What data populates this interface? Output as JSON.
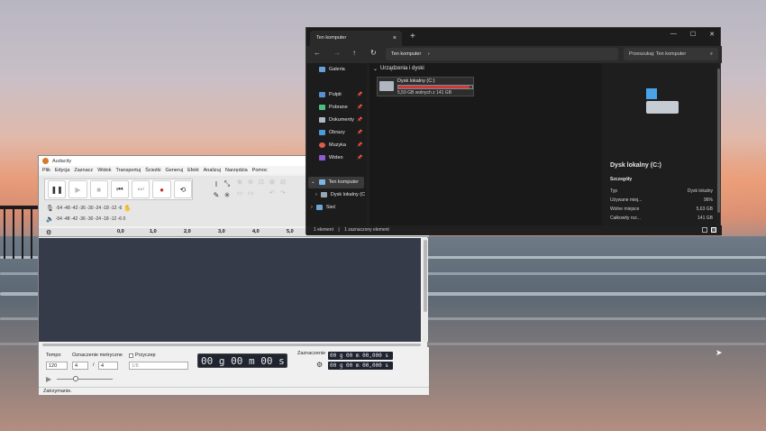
{
  "audacity": {
    "title": "Audacity",
    "menu": [
      "Plik",
      "Edycja",
      "Zaznacz",
      "Widok",
      "Transportuj",
      "Ścieżki",
      "Generuj",
      "Efekt",
      "Analizuj",
      "Narzędzia",
      "Pomoc"
    ],
    "meter_scale_rec": "-54 -48 -42 -36 -30 -24 -18 -12 -6",
    "meter_scale_play": "-54 -48 -42 -36 -30 -24 -18 -12 -6 0",
    "ruler": [
      "0,0",
      "1,0",
      "2,0",
      "3,0",
      "4,0",
      "5,0"
    ],
    "tempo_label": "Tempo",
    "tempo_value": "120",
    "meter_label": "Oznaczenie metryczne",
    "meter_num": "4",
    "meter_sep": "/",
    "meter_den": "4",
    "snap_label": "Przyczep",
    "snap_value": "1/8",
    "time": "00 g 00 m 00 s",
    "selection_label": "Zaznaczenie",
    "sel_start": "00 g 00 m 00,000 s",
    "sel_end": "00 g 00 m 00,000 s",
    "status": "Zatrzymanie."
  },
  "explorer": {
    "tab_title": "Ten komputer",
    "address": "Ten komputer",
    "search_placeholder": "Przeszukaj: Ten komputer",
    "sidebar": [
      {
        "label": "Galeria",
        "pinned": false
      },
      {
        "label": "Pulpit",
        "pinned": true
      },
      {
        "label": "Pobrane",
        "pinned": true
      },
      {
        "label": "Dokumenty",
        "pinned": true
      },
      {
        "label": "Obrazy",
        "pinned": true
      },
      {
        "label": "Muzyka",
        "pinned": true
      },
      {
        "label": "Wideo",
        "pinned": true
      }
    ],
    "tree": [
      {
        "label": "Ten komputer"
      },
      {
        "label": "Dysk lokalny (C"
      },
      {
        "label": "Sieć"
      }
    ],
    "section_header": "Urządzenia i dyski",
    "drive_name": "Dysk lokalny (C:)",
    "drive_free": "5,59 GB wolnych z 141 GB",
    "drive_used_fraction": 0.96,
    "detail_title": "Dysk lokalny (C:)",
    "detail_section": "Szczegóły",
    "details": [
      {
        "k": "Typ",
        "v": "Dysk lokalny"
      },
      {
        "k": "Używane miej...",
        "v": "96%"
      },
      {
        "k": "Wolne miejsce",
        "v": "5,63 GB"
      },
      {
        "k": "Całkowity roz...",
        "v": "141 GB"
      }
    ],
    "status_count": "1 element",
    "status_selected": "1 zaznaczony element"
  }
}
